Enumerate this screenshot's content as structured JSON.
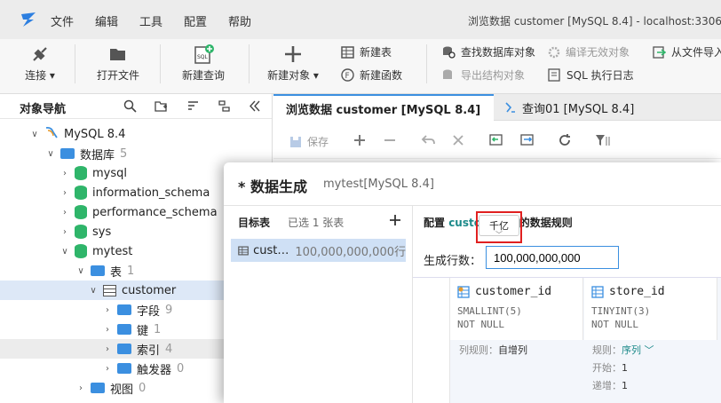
{
  "menu": [
    "文件",
    "编辑",
    "工具",
    "配置",
    "帮助"
  ],
  "window_title": "浏览数据 customer [MySQL 8.4]  - localhost:3306",
  "toolbar": {
    "connect": "连接",
    "open_file": "打开文件",
    "new_query": "新建查询",
    "new_object": "新建对象",
    "new_table": "新建表",
    "new_function": "新建函数",
    "find_objects": "查找数据库对象",
    "compile_invalid": "编译无效对象",
    "export_ddl": "导出结构对象",
    "sql_log": "SQL 执行日志",
    "import_from_file": "从文件导入"
  },
  "nav": {
    "title": "对象导航",
    "tree": [
      {
        "label": "MySQL 8.4",
        "count": "",
        "level": 0,
        "type": "conn",
        "exp": "down"
      },
      {
        "label": "数据库",
        "count": "5",
        "level": 1,
        "type": "folder",
        "exp": "down"
      },
      {
        "label": "mysql",
        "count": "",
        "level": 2,
        "type": "db",
        "exp": "right"
      },
      {
        "label": "information_schema",
        "count": "",
        "level": 2,
        "type": "db",
        "exp": "right"
      },
      {
        "label": "performance_schema",
        "count": "",
        "level": 2,
        "type": "db",
        "exp": "right"
      },
      {
        "label": "sys",
        "count": "",
        "level": 2,
        "type": "db",
        "exp": "right"
      },
      {
        "label": "mytest",
        "count": "",
        "level": 2,
        "type": "db",
        "exp": "down"
      },
      {
        "label": "表",
        "count": "1",
        "level": 3,
        "type": "folder",
        "exp": "down"
      },
      {
        "label": "customer",
        "count": "",
        "level": 4,
        "type": "tbl",
        "exp": "down",
        "sel": true
      },
      {
        "label": "字段",
        "count": "9",
        "level": 5,
        "type": "folder",
        "exp": "right"
      },
      {
        "label": "键",
        "count": "1",
        "level": 5,
        "type": "folder",
        "exp": "right"
      },
      {
        "label": "索引",
        "count": "4",
        "level": 5,
        "type": "folder",
        "exp": "right",
        "hover": true
      },
      {
        "label": "触发器",
        "count": "0",
        "level": 5,
        "type": "folder",
        "exp": "right"
      },
      {
        "label": "视图",
        "count": "0",
        "level": 3,
        "type": "folder",
        "exp": "right"
      }
    ]
  },
  "tabs": [
    {
      "label": "浏览数据 customer [MySQL 8.4]",
      "active": true
    },
    {
      "label": "查询01 [MySQL 8.4]",
      "active": false
    }
  ],
  "subtoolbar": {
    "save": "保存"
  },
  "dialog": {
    "title": "* 数据生成",
    "subtitle": "mytest[MySQL 8.4]",
    "target_label": "目标表",
    "selected_count": "已选 1 张表",
    "selected_table": "cust…",
    "selected_rows": "100,000,000,000行",
    "config_prefix": "配置 ",
    "config_table": "customer",
    "config_suffix": " 表的数据规则",
    "rows_label": "生成行数：",
    "rows_value": "100,000,000,000",
    "tooltip": "千亿",
    "columns": [
      {
        "name": "customer_id",
        "type": "SMALLINT(5)",
        "null": "NOT NULL",
        "rule_label": "列规则：",
        "rule": "自增列"
      },
      {
        "name": "store_id",
        "type": "TINYINT(3)",
        "null": "NOT NULL",
        "rule_label": "规则：",
        "rule": "序列",
        "start_label": "开始：",
        "start": "1",
        "step_label": "递增：",
        "step": "1"
      }
    ]
  }
}
